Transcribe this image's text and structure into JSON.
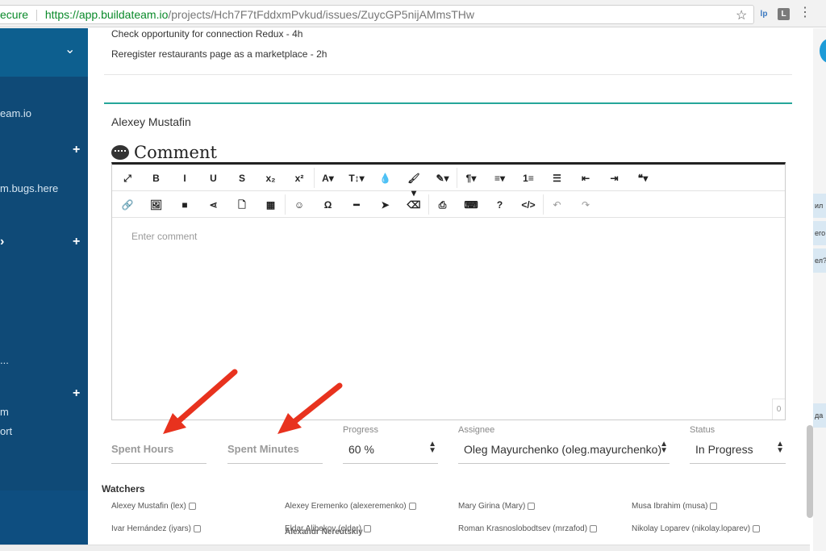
{
  "browser": {
    "secure_label": "ecure",
    "url_host": "https://app.buildateam.io",
    "url_path": "/projects/Hch7F7tFddxmPvkud/issues/ZuycGP5nijAMmsTHw",
    "ext1": "lp",
    "ext2": "L"
  },
  "sidebar": {
    "items": [
      {
        "label": "eam.io"
      },
      {
        "label": "m.bugs.here"
      },
      {
        "label": "..."
      },
      {
        "label": "m"
      },
      {
        "label": "ort"
      }
    ],
    "plus": "+"
  },
  "tasks": [
    "Check opportunity for connection Redux - 4h",
    "Reregister restaurants page as a marketplace - 2h"
  ],
  "comment": {
    "author": "Alexey Mustafin",
    "heading": "Comment",
    "placeholder": "Enter comment",
    "counter": "0"
  },
  "toolbar": {
    "row1": [
      "⤢",
      "B",
      "I",
      "U",
      "S",
      "x₂",
      "x²",
      "A▾",
      "T↕▾",
      "💧",
      "🖌▾",
      "✎▾",
      "¶▾",
      "≡▾",
      "1≡",
      "☰",
      "⇤",
      "⇥",
      "❝▾"
    ],
    "row2": [
      "🔗",
      "🖼",
      "■",
      "⋖",
      "🗋",
      "▦",
      "☺",
      "Ω",
      "━",
      "➤",
      "⌫",
      "⎙",
      "⌨",
      "?",
      "</>",
      "↶",
      "↷"
    ]
  },
  "fields": {
    "spent_hours_placeholder": "Spent Hours",
    "spent_minutes_placeholder": "Spent Minutes",
    "progress_label": "Progress",
    "progress_value": "60 %",
    "assignee_label": "Assignee",
    "assignee_value": "Oleg Mayurchenko (oleg.mayurchenko)",
    "status_label": "Status",
    "status_value": "In Progress"
  },
  "watchers": {
    "heading": "Watchers",
    "row1": [
      "Alexey Mustafin (lex)",
      "Alexey Eremenko (alexeremenko)",
      "Mary Girina (Mary)",
      "Musa Ibrahim (musa)"
    ],
    "row2": [
      "Ivar Hernández (iyars)",
      "Eldar Alibekov (eldar)",
      "Roman Krasnoslobodtsev (mrzafod)",
      "Nikolay Loparev (nikolay.loparev)"
    ],
    "overlap": "Alexandr Nereutskiy"
  },
  "right_panel": {
    "chips": [
      "ил",
      "его",
      "ел?",
      "да"
    ]
  },
  "colors": {
    "sidebar": "#0f4a77",
    "accent": "#26a69a",
    "arrow": "#e8321e"
  }
}
